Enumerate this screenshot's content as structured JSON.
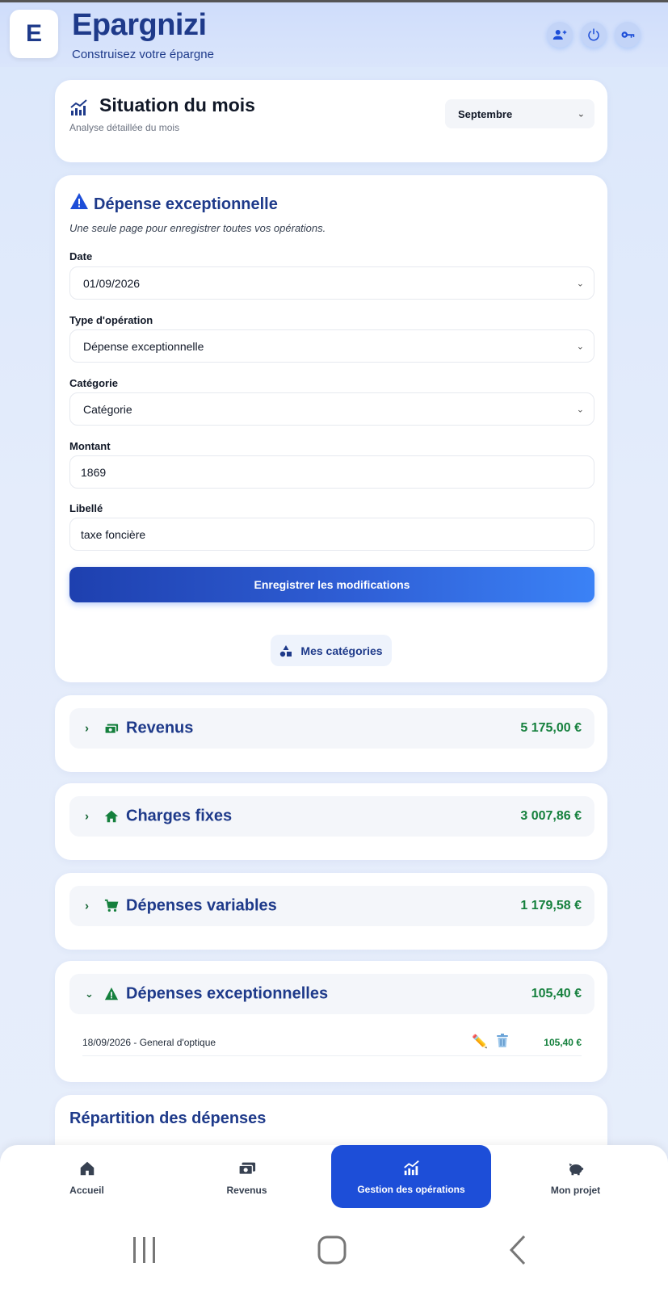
{
  "app": {
    "logo_letter": "E",
    "title": "Epargnizi",
    "subtitle": "Construisez votre épargne"
  },
  "header_buttons": [
    {
      "name": "add-user-icon"
    },
    {
      "name": "power-icon"
    },
    {
      "name": "key-icon"
    }
  ],
  "situation": {
    "title": "Situation du mois",
    "subtitle": "Analyse détaillée du mois",
    "month": "Septembre"
  },
  "form": {
    "title": "Dépense exceptionnelle",
    "description": "Une seule page pour enregistrer toutes vos opérations.",
    "date_label": "Date",
    "date_value": "01/09/2026",
    "type_label": "Type d'opération",
    "type_value": "Dépense exceptionnelle",
    "category_label": "Catégorie",
    "category_value": "Catégorie",
    "amount_label": "Montant",
    "amount_value": "1869",
    "libelle_label": "Libellé",
    "libelle_value": "taxe foncière",
    "save_label": "Enregistrer les modifications",
    "categories_label": "Mes catégories"
  },
  "sections": [
    {
      "label": "Revenus",
      "amount": "5 175,00 €",
      "icon": "money-icon",
      "expanded": false
    },
    {
      "label": "Charges fixes",
      "amount": "3 007,86 €",
      "icon": "home-icon",
      "expanded": false
    },
    {
      "label": "Dépenses variables",
      "amount": "1 179,58 €",
      "icon": "cart-icon",
      "expanded": false
    },
    {
      "label": "Dépenses exceptionnelles",
      "amount": "105,40 €",
      "icon": "warning-icon",
      "expanded": true
    }
  ],
  "operations": [
    {
      "text": "18/09/2026 - General d'optique",
      "amount": "105,40 €"
    }
  ],
  "repartition": {
    "title": "Répartition des dépenses"
  },
  "nav": [
    {
      "label": "Accueil",
      "icon": "home-icon"
    },
    {
      "label": "Revenus",
      "icon": "money-icon"
    },
    {
      "label": "Gestion des opérations",
      "icon": "chart-icon",
      "active": true
    },
    {
      "label": "Mon projet",
      "icon": "piggy-bank-icon"
    }
  ],
  "colors": {
    "primary": "#1e3a8a",
    "accent": "#1d4ed8",
    "positive": "#15803d"
  }
}
